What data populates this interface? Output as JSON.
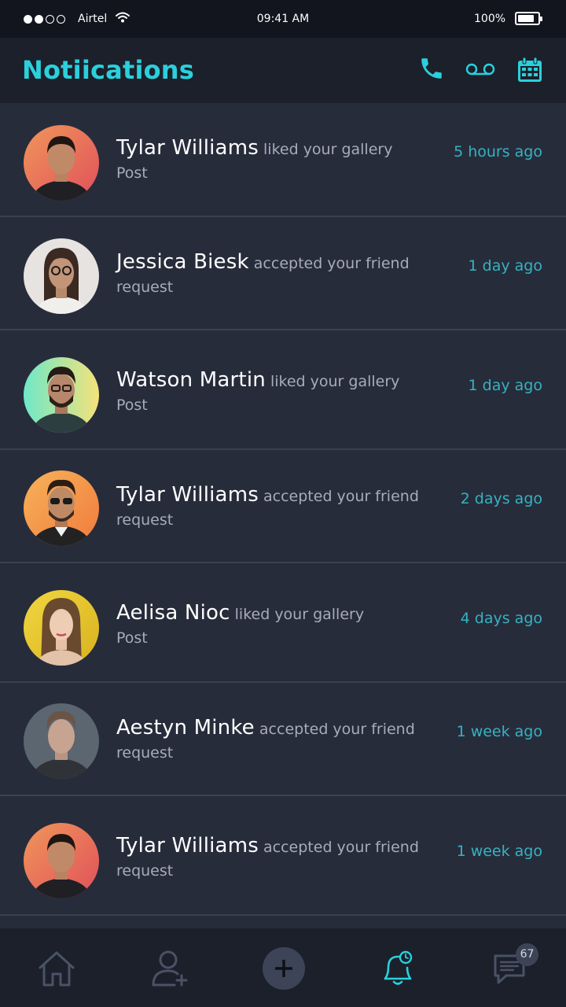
{
  "status_bar": {
    "carrier": "Airtel",
    "time": "09:41 AM",
    "battery": "100%",
    "battery_level": 0.85,
    "signal_bars_filled": 2,
    "signal_bars_total": 4
  },
  "header": {
    "title": "Notiications",
    "icons": [
      "phone-icon",
      "voicemail-icon",
      "calendar-icon"
    ],
    "accent_color": "#2ad0dc"
  },
  "notifications": [
    {
      "name": "Tylar Williams",
      "action": "liked your gallery",
      "action_cont": "Post",
      "time": "5 hours ago"
    },
    {
      "name": "Jessica Biesk",
      "action": "accepted your friend",
      "action_cont": "request",
      "time": "1 day ago"
    },
    {
      "name": "Watson Martin",
      "action": "liked your gallery",
      "action_cont": "Post",
      "time": "1 day ago"
    },
    {
      "name": "Tylar Williams",
      "action": "accepted your friend",
      "action_cont": "request",
      "time": "2 days ago"
    },
    {
      "name": "Aelisa Nioc",
      "action": "liked your gallery",
      "action_cont": "Post",
      "time": "4 days ago"
    },
    {
      "name": "Aestyn Minke",
      "action": "accepted your friend",
      "action_cont": "request",
      "time": "1 week ago"
    },
    {
      "name": "Tylar Williams",
      "action": "accepted your friend",
      "action_cont": "request",
      "time": "1 week ago"
    }
  ],
  "bottom_nav": {
    "items": [
      "home-icon",
      "add-user-icon",
      "plus-icon",
      "bell-icon",
      "chat-icon"
    ],
    "active": "bell-icon",
    "chat_badge": "67"
  }
}
